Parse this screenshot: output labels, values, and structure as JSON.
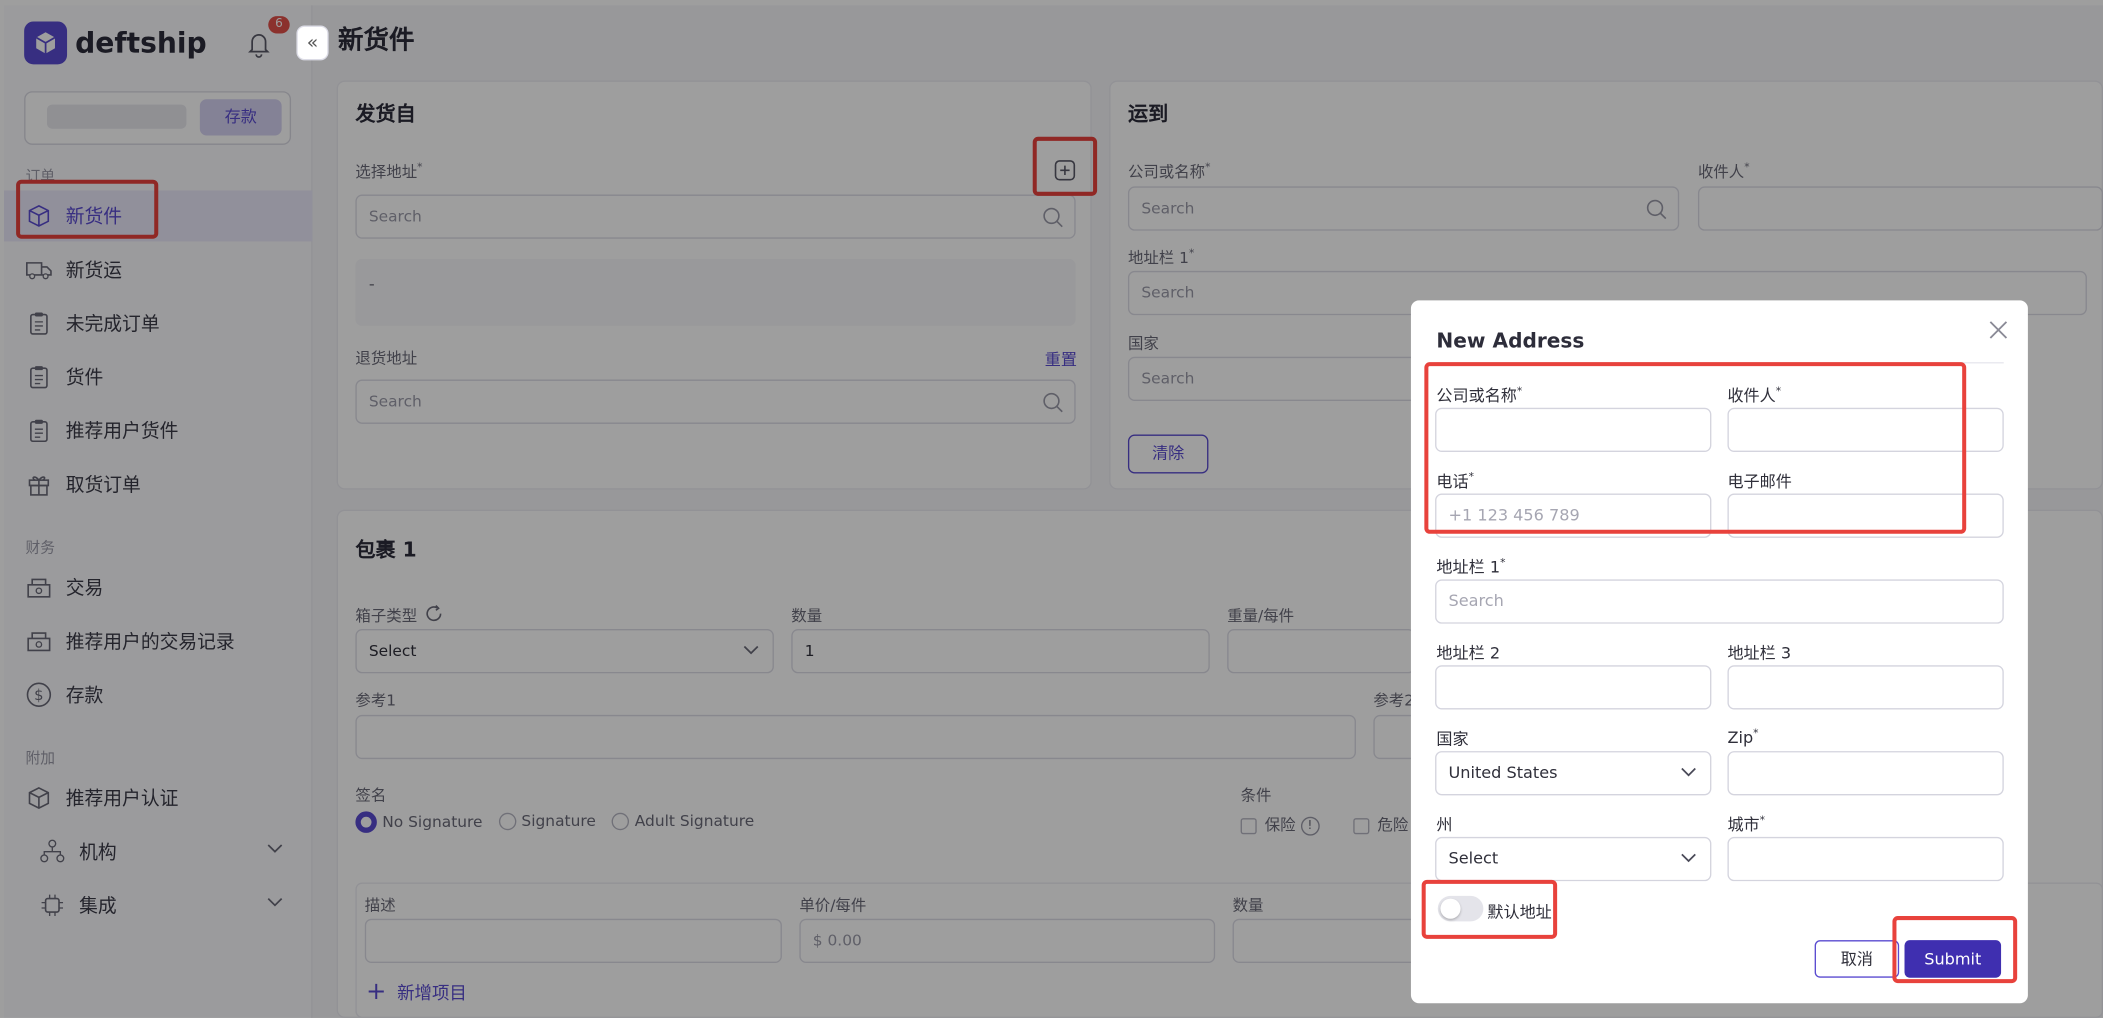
{
  "app": {
    "brand": "deftship",
    "notification_count": "6",
    "deposit_button": "存款",
    "page_title": "新货件"
  },
  "sidebar": {
    "sections": {
      "orders": "订单",
      "finance": "财务",
      "extra": "附加"
    },
    "items": [
      {
        "label": "新货件",
        "icon": "box-icon"
      },
      {
        "label": "新货运",
        "icon": "truck-icon"
      },
      {
        "label": "未完成订单",
        "icon": "clipboard-icon"
      },
      {
        "label": "货件",
        "icon": "clipboard-icon"
      },
      {
        "label": "推荐用户货件",
        "icon": "clipboard-icon"
      },
      {
        "label": "取货订单",
        "icon": "gift-icon"
      },
      {
        "label": "交易",
        "icon": "cash-icon"
      },
      {
        "label": "推荐用户的交易记录",
        "icon": "cash-icon"
      },
      {
        "label": "存款",
        "icon": "dollar-icon"
      },
      {
        "label": "推荐用户认证",
        "icon": "cube-icon"
      },
      {
        "label": "机构",
        "icon": "org-icon"
      },
      {
        "label": "集成",
        "icon": "chip-icon"
      }
    ]
  },
  "ship_from": {
    "title": "发货自",
    "select_address_label": "选择地址",
    "search_placeholder": "Search",
    "address_value": "-",
    "return_label": "退货地址",
    "reset_link": "重置"
  },
  "ship_to": {
    "title": "运到",
    "company_label": "公司或名称",
    "recipient_label": "收件人",
    "address1_label": "地址栏 1",
    "country_label": "国家",
    "search_placeholder": "Search",
    "clear_button": "清除"
  },
  "package": {
    "title": "包裹 1",
    "box_type_label": "箱子类型",
    "box_type_value": "Select",
    "quantity_label": "数量",
    "quantity_value": "1",
    "weight_label": "重量/每件",
    "ref1_label": "参考1",
    "ref2_label": "参考2",
    "signature_label": "签名",
    "signature_options": [
      "No Signature",
      "Signature",
      "Adult Signature"
    ],
    "conditions_label": "条件",
    "insurance_label": "保险",
    "dangerous_label": "危险",
    "description_label": "描述",
    "unit_price_label": "单价/每件",
    "unit_price_placeholder": "$  0.00",
    "items_qty_label": "数量",
    "add_item": "新增项目"
  },
  "modal": {
    "title": "New Address",
    "company_label": "公司或名称",
    "recipient_label": "收件人",
    "phone_label": "电话",
    "phone_placeholder": "+1 123 456 789",
    "email_label": "电子邮件",
    "address1_label": "地址栏 1",
    "address1_placeholder": "Search",
    "address2_label": "地址栏 2",
    "address3_label": "地址栏 3",
    "country_label": "国家",
    "country_value": "United States",
    "zip_label": "Zip",
    "state_label": "州",
    "state_value": "Select",
    "city_label": "城市",
    "default_label": "默认地址",
    "default_on": false,
    "cancel_button": "取消",
    "submit_button": "Submit"
  },
  "colors": {
    "accent": "#5a4bd0",
    "submit": "#3f2fb0",
    "highlight": "#e8423c",
    "badge": "#e0504a"
  }
}
